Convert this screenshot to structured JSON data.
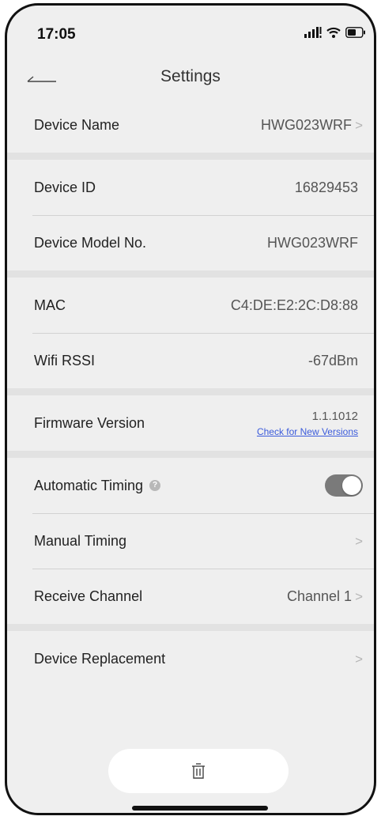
{
  "status_bar": {
    "time": "17:05",
    "icons": [
      "cellular-signal-icon",
      "wifi-icon",
      "battery-icon"
    ]
  },
  "nav": {
    "title": "Settings",
    "back_icon": "back-arrow-icon"
  },
  "rows": {
    "device_name": {
      "label": "Device Name",
      "value": "HWG023WRF",
      "chevron": ">"
    },
    "device_id": {
      "label": "Device ID",
      "value": "16829453"
    },
    "device_model": {
      "label": "Device Model No.",
      "value": "HWG023WRF"
    },
    "mac": {
      "label": "MAC",
      "value": "C4:DE:E2:2C:D8:88"
    },
    "wifi_rssi": {
      "label": "Wifi RSSI",
      "value": "-67dBm"
    },
    "firmware": {
      "label": "Firmware Version",
      "value": "1.1.1012",
      "link": "Check for New Versions"
    },
    "automatic_timing": {
      "label": "Automatic Timing",
      "help": "?",
      "toggle_on": true
    },
    "manual_timing": {
      "label": "Manual Timing",
      "chevron": ">"
    },
    "receive_channel": {
      "label": "Receive Channel",
      "value": "Channel 1",
      "chevron": ">"
    },
    "device_replacement": {
      "label": "Device Replacement",
      "chevron": ">"
    }
  },
  "footer": {
    "delete_icon": "trash-icon"
  },
  "colors": {
    "background": "#efefef",
    "separator": "#e2e2e2",
    "link": "#3b5bdb",
    "toggle_on": "#7a7a7a"
  }
}
